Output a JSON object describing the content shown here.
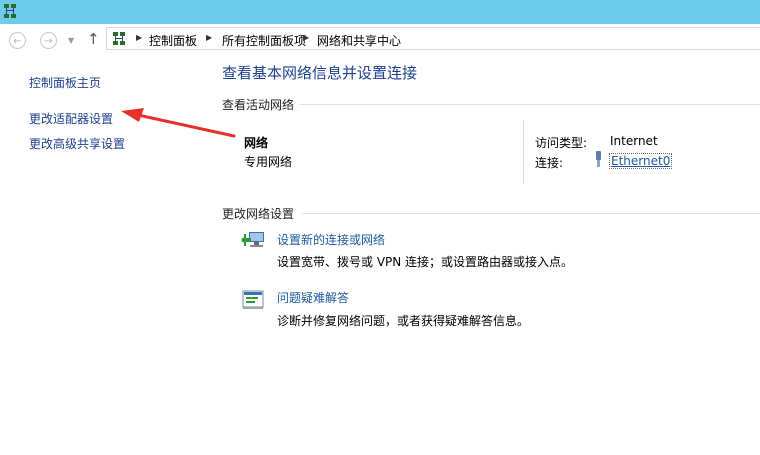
{
  "titlebar": {
    "color": "#6ecbeb"
  },
  "nav": {
    "back_icon": "back-arrow-icon",
    "forward_icon": "forward-arrow-icon",
    "dropdown_icon": "chevron-down-icon",
    "up_icon": "up-arrow-icon",
    "breadcrumbs": [
      "控制面板",
      "所有控制面板项",
      "网络和共享中心"
    ]
  },
  "sidebar": {
    "items": [
      {
        "label": "控制面板主页"
      },
      {
        "label": "更改适配器设置"
      },
      {
        "label": "更改高级共享设置"
      }
    ]
  },
  "main": {
    "title": "查看基本网络信息并设置连接",
    "active_section": {
      "title": "查看活动网络",
      "network_name": "网络",
      "network_type": "专用网络",
      "access_type_label": "访问类型:",
      "access_type_value": "Internet",
      "connection_label": "连接:",
      "connection_value": "Ethernet0"
    },
    "change_section": {
      "title": "更改网络设置",
      "items": [
        {
          "link": "设置新的连接或网络",
          "desc": "设置宽带、拨号或 VPN 连接；或设置路由器或接入点。",
          "icon": "new-connection-icon"
        },
        {
          "link": "问题疑难解答",
          "desc": "诊断并修复网络问题，或者获得疑难解答信息。",
          "icon": "troubleshoot-icon"
        }
      ]
    }
  },
  "annotation": {
    "arrow_color": "#e8302a"
  },
  "colors": {
    "link": "#1e5aa0",
    "heading": "#1e3f8f"
  }
}
